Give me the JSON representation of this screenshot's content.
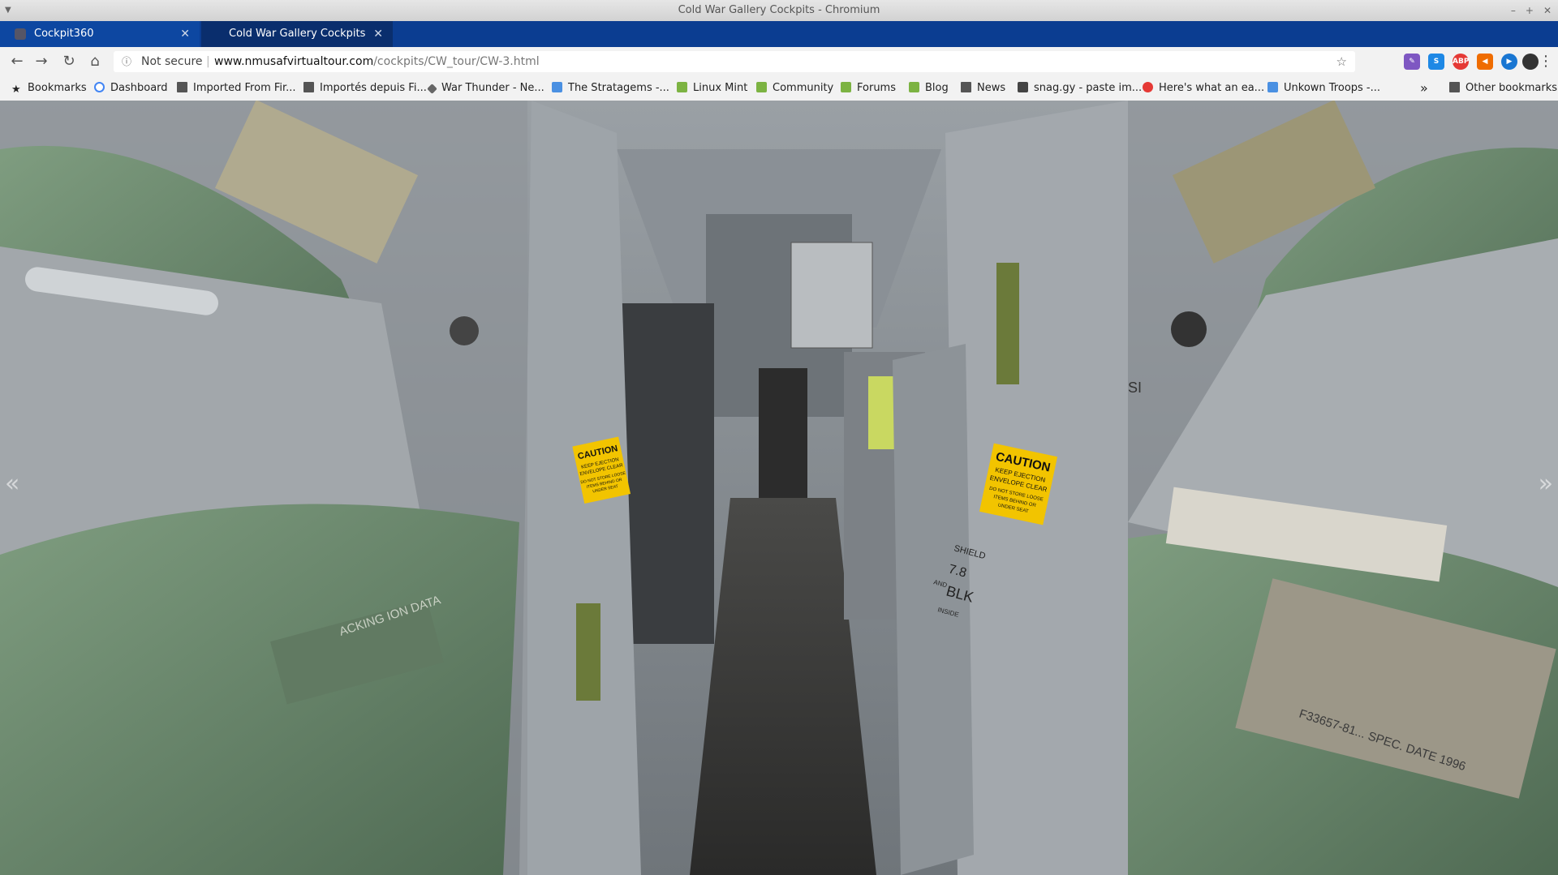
{
  "window": {
    "title": "Cold War Gallery Cockpits - Chromium"
  },
  "tabs": [
    {
      "label": "Cockpit360",
      "active": false
    },
    {
      "label": "Cold War Gallery Cockpits",
      "active": true
    }
  ],
  "toolbar": {
    "security_label": "Not secure",
    "url_host": "www.nmusafvirtualtour.com",
    "url_path": "/cockpits/CW_tour/CW-3.html"
  },
  "bookmarks": {
    "items": [
      {
        "label": "Bookmarks",
        "icon": "star-icon"
      },
      {
        "label": "Dashboard",
        "icon": "google-icon"
      },
      {
        "label": "Imported From Fir...",
        "icon": "folder-icon"
      },
      {
        "label": "Importés depuis Fi...",
        "icon": "folder-icon"
      },
      {
        "label": "War Thunder - Ne...",
        "icon": "war-thunder-icon"
      },
      {
        "label": "The Stratagems -...",
        "icon": "doc-icon"
      },
      {
        "label": "Linux Mint",
        "icon": "mint-icon"
      },
      {
        "label": "Community",
        "icon": "mint-icon"
      },
      {
        "label": "Forums",
        "icon": "mint-icon"
      },
      {
        "label": "Blog",
        "icon": "mint-icon"
      },
      {
        "label": "News",
        "icon": "folder-icon"
      },
      {
        "label": "snag.gy - paste im...",
        "icon": "snaggy-icon"
      },
      {
        "label": "Here's what an ea...",
        "icon": "power-icon"
      },
      {
        "label": "Unkown Troops -...",
        "icon": "doc-icon"
      }
    ],
    "overflow": "»",
    "other": "Other bookmarks"
  },
  "viewer": {
    "caution_left": [
      "CAUTION",
      "KEEP EJECTION",
      "ENVELOPE CLEAR",
      "DO NOT STORE LOOSE",
      "ITEMS BEHIND OR",
      "UNDER SEAT"
    ],
    "caution_right": [
      "CAUTION",
      "KEEP EJECTION",
      "ENVELOPE CLEAR",
      "DO NOT STORE LOOSE",
      "ITEMS BEHIND OR",
      "UNDER SEAT"
    ],
    "panel_text": [
      "SHIELD",
      "7.8",
      "BLK",
      "AND",
      "INSIDE"
    ],
    "si_label": "SI",
    "cushion_text": "ACKING\nION DATA",
    "placard_text": "F33657-81...\nSPEC. DATE 1996",
    "prev_arrow": "«",
    "next_arrow": "»"
  }
}
